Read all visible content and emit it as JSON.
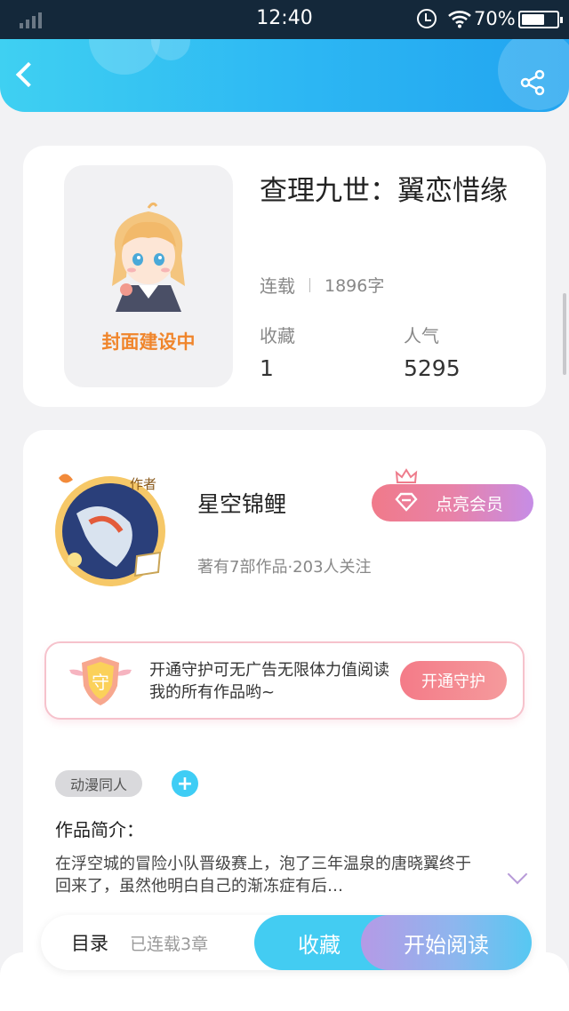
{
  "status_bar": {
    "time": "12:40",
    "battery": "70%",
    "battery_level_pct": 70,
    "icons": [
      "signal-icon",
      "alarm-icon",
      "wifi-icon",
      "battery-icon"
    ]
  },
  "header": {
    "icons": [
      "back-icon",
      "share-icon"
    ],
    "colors": {
      "gradient_start": "#3fd0f2",
      "gradient_end": "#22a4f0"
    }
  },
  "book": {
    "cover_text": "封面建设中",
    "title": "查理九世：翼恋惜缘",
    "status": "连载",
    "word_count": "1896字",
    "stats": [
      {
        "label": "收藏",
        "value": "1"
      },
      {
        "label": "人气",
        "value": "5295"
      }
    ]
  },
  "author": {
    "badge": "作者",
    "name": "星空锦鲤",
    "info": "著有7部作品·203人关注",
    "vip_button": "点亮会员"
  },
  "guard": {
    "icon_text": "守",
    "text": "开通守护可无广告无限体力值阅读我的所有作品哟~",
    "button": "开通守护"
  },
  "tags": [
    "动漫同人"
  ],
  "intro": {
    "label": "作品简介：",
    "text": "在浮空城的冒险小队晋级赛上，泡了三年温泉的唐晓翼终于回来了，虽然他明白自己的渐冻症有后…"
  },
  "bottom_bar": {
    "toc": "目录",
    "chapters": "已连载3章",
    "collect": "收藏",
    "read": "开始阅读"
  }
}
